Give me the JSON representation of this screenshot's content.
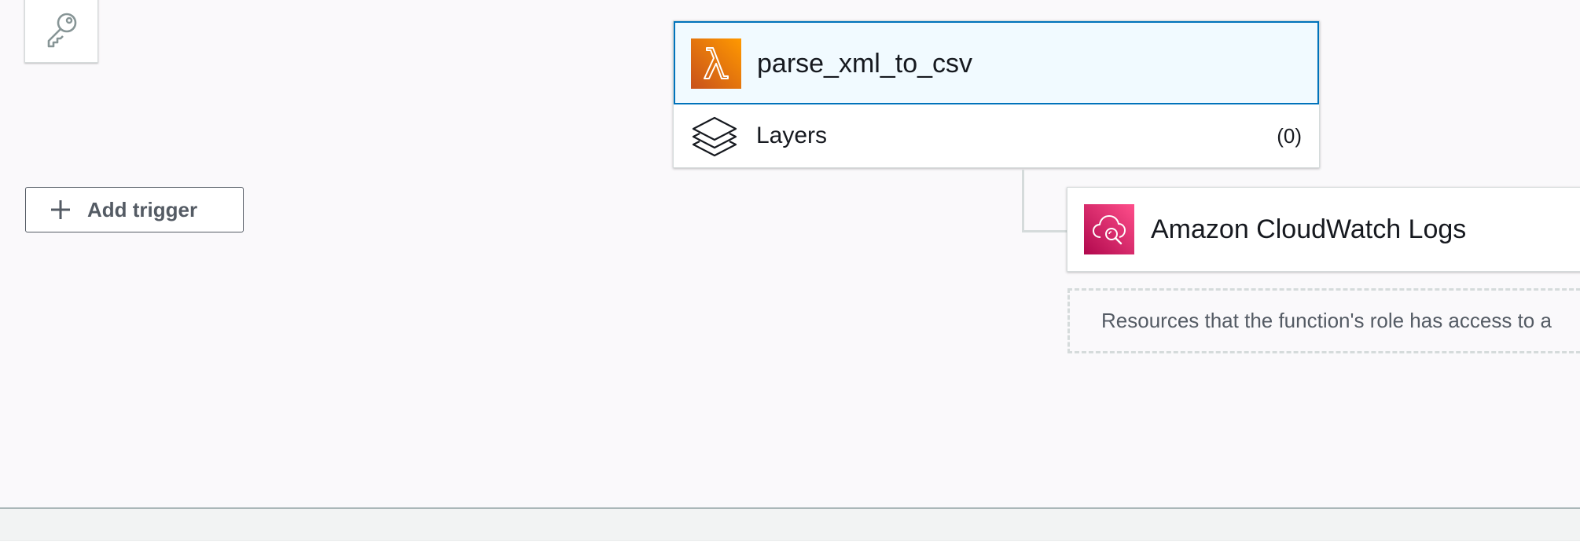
{
  "icons": {
    "permissions": "key-icon",
    "add": "plus-icon",
    "function": "lambda-icon",
    "layers": "layers-icon",
    "destination": "cloudwatch-logs-icon"
  },
  "colors": {
    "selected_border": "#0073bb",
    "selected_fill": "#f1faff",
    "lambda_orange": "#e07b18",
    "cloudwatch_pink": "#d13a7b",
    "button_text": "#545b64"
  },
  "designer": {
    "add_trigger_label": "Add trigger",
    "function": {
      "name": "parse_xml_to_csv",
      "layers_label": "Layers",
      "layers_count": "(0)"
    },
    "destinations": [
      {
        "name": "Amazon CloudWatch Logs"
      }
    ],
    "resources_note": "Resources that the function's role has access to a"
  }
}
